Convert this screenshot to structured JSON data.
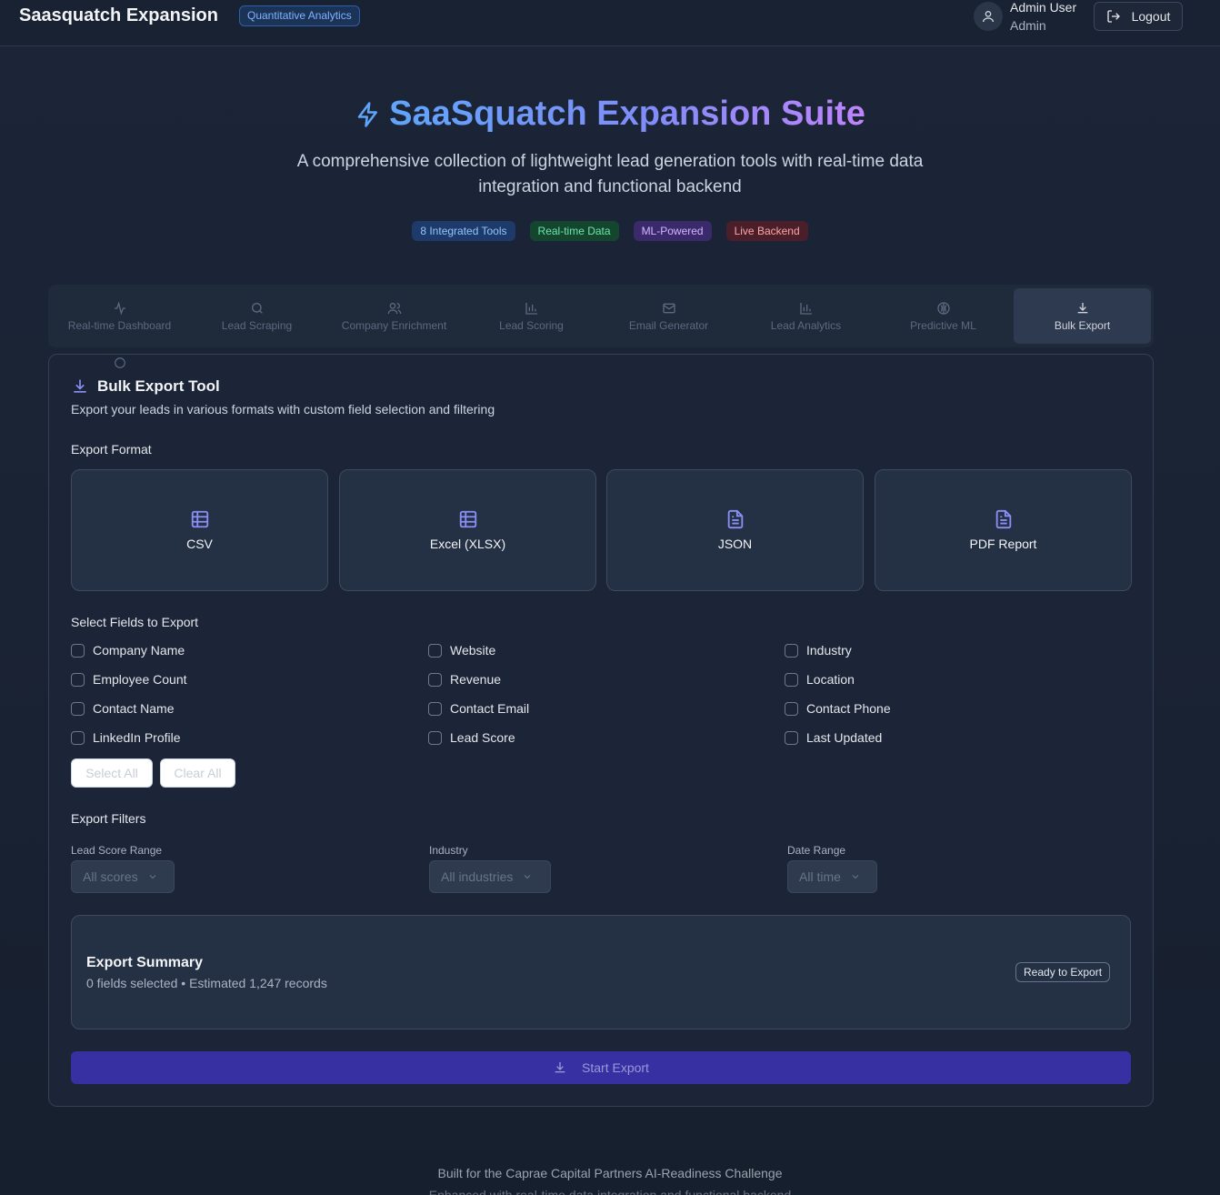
{
  "header": {
    "brand": "Saasquatch Expansion",
    "badge": "Quantitative Analytics",
    "user_name": "Admin User",
    "user_role": "Admin",
    "logout_label": "Logout"
  },
  "hero": {
    "title": "SaaSquatch Expansion Suite",
    "subtitle": "A comprehensive collection of lightweight lead generation tools with real-time data integration and functional backend",
    "pills": [
      "8 Integrated Tools",
      "Real-time Data",
      "ML-Powered",
      "Live Backend"
    ]
  },
  "tabs": [
    {
      "label": "Real-time Dashboard",
      "icon": "activity-icon"
    },
    {
      "label": "Lead Scraping",
      "icon": "search-icon"
    },
    {
      "label": "Company Enrichment",
      "icon": "users-icon"
    },
    {
      "label": "Lead Scoring",
      "icon": "bar-chart-icon"
    },
    {
      "label": "Email Generator",
      "icon": "mail-icon"
    },
    {
      "label": "Lead Analytics",
      "icon": "bar-chart-icon"
    },
    {
      "label": "Predictive ML",
      "icon": "brain-icon"
    },
    {
      "label": "Bulk Export",
      "icon": "download-icon",
      "active": true
    }
  ],
  "tool": {
    "title": "Bulk Export Tool",
    "description": "Export your leads in various formats with custom field selection and filtering",
    "export_format_label": "Export Format",
    "formats": [
      "CSV",
      "Excel (XLSX)",
      "JSON",
      "PDF Report"
    ],
    "fields_label": "Select Fields to Export",
    "fields": [
      "Company Name",
      "Website",
      "Industry",
      "Employee Count",
      "Revenue",
      "Location",
      "Contact Name",
      "Contact Email",
      "Contact Phone",
      "LinkedIn Profile",
      "Lead Score",
      "Last Updated"
    ],
    "select_all": "Select All",
    "clear_all": "Clear All",
    "filters_label": "Export Filters",
    "filters": [
      {
        "label": "Lead Score Range",
        "value": "All scores"
      },
      {
        "label": "Industry",
        "value": "All industries"
      },
      {
        "label": "Date Range",
        "value": "All time"
      }
    ],
    "summary_title": "Export Summary",
    "summary_sub": "0 fields selected • Estimated 1,247 records",
    "ready_badge": "Ready to Export",
    "start_button": "Start Export"
  },
  "footer": {
    "line1": "Built for the Caprae Capital Partners AI-Readiness Challenge",
    "line2": "Enhanced with real-time data integration and functional backend"
  },
  "colors": {
    "accent": "#3730a3",
    "brand_badge": "#7fb3ff",
    "icon_accent": "#8b8ff5"
  }
}
